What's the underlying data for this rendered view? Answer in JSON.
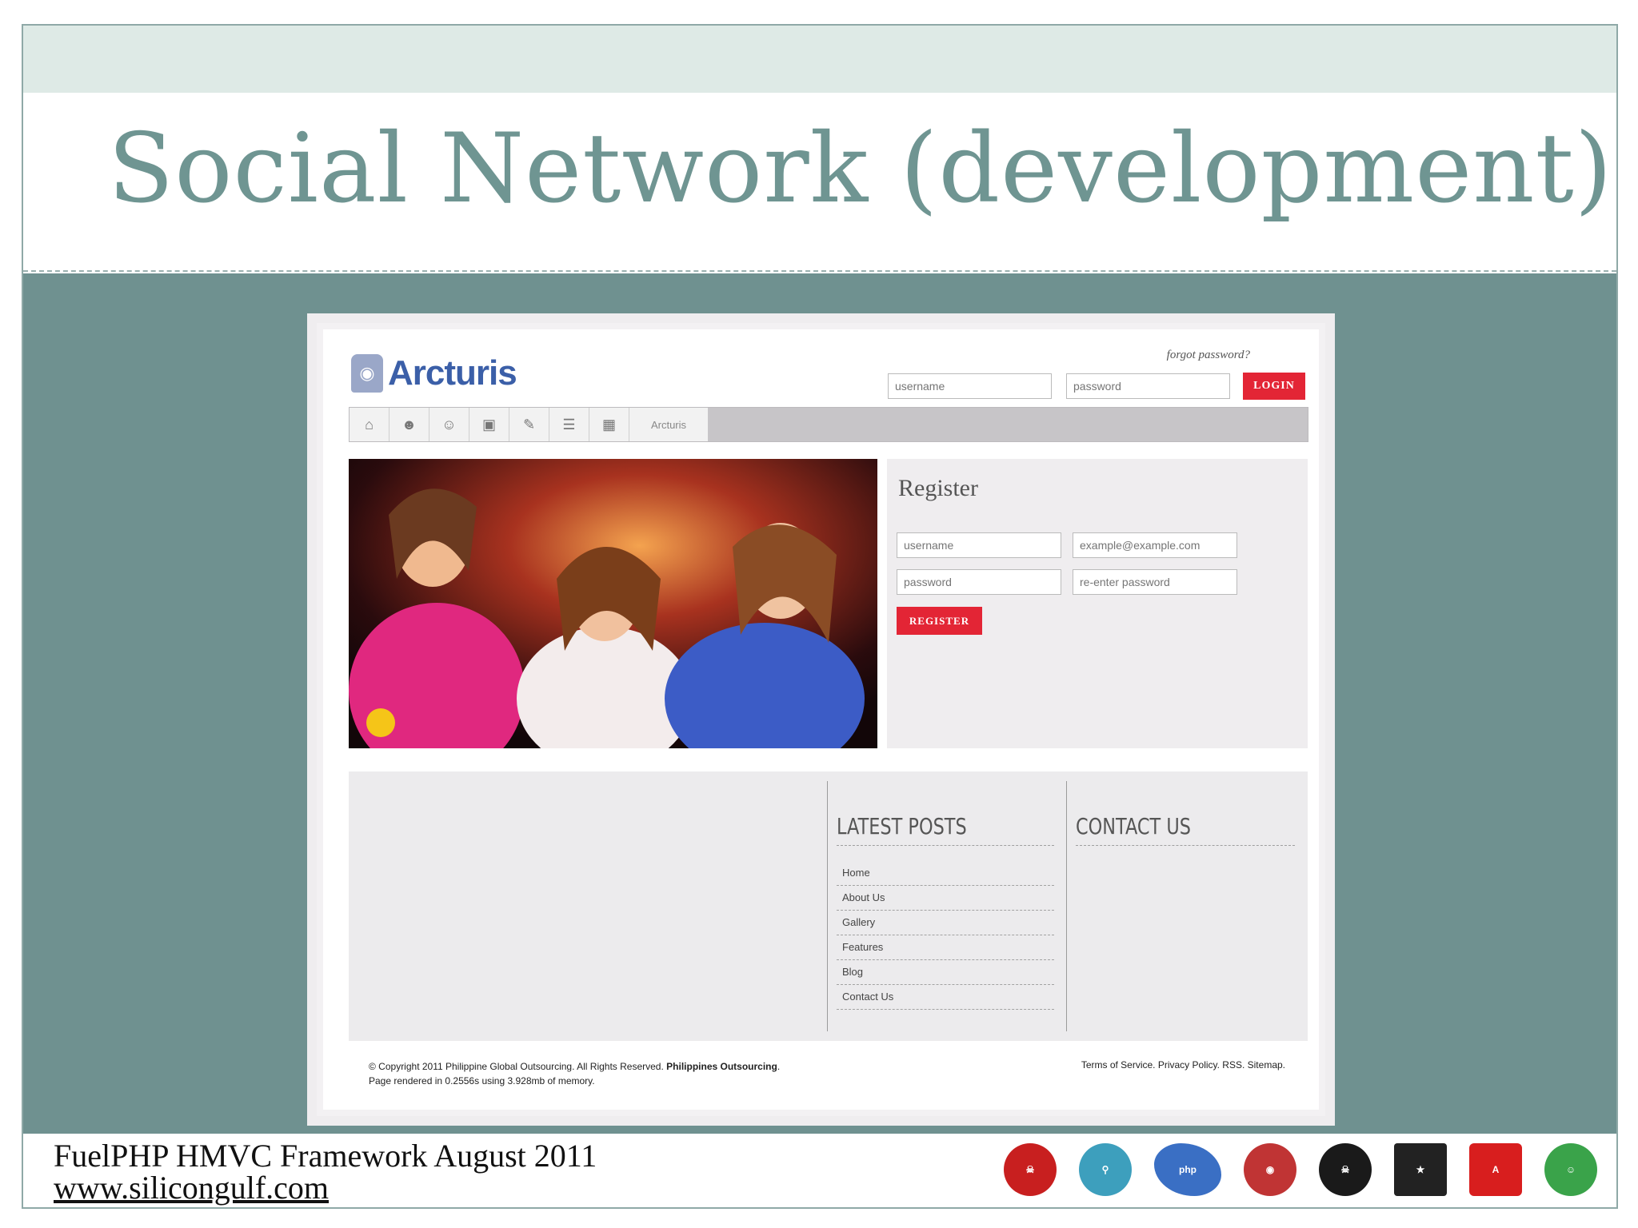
{
  "slide": {
    "title": "Social Network (development)",
    "footer_line1": "FuelPHP HMVC Framework August 2011",
    "footer_line2": "www.silicongulf.com"
  },
  "logos": [
    "sniper-thermos-logo",
    "silicongulf-logo",
    "php-logo",
    "red-shield-logo",
    "skull-logo",
    "kickstart-logo",
    "adobe-user-group-logo",
    "green-face-logo"
  ],
  "site": {
    "brand": "Arcturis",
    "forgot_password": "forgot password?",
    "login": {
      "username_placeholder": "username",
      "password_placeholder": "password",
      "button": "LOGIN"
    },
    "nav": {
      "icons": [
        "home-icon",
        "user-icon",
        "users-icon",
        "image-icon",
        "edit-icon",
        "list-icon",
        "book-icon"
      ],
      "text_item": "Arcturis"
    },
    "register": {
      "title": "Register",
      "username_placeholder": "username",
      "email_placeholder": "example@example.com",
      "password_placeholder": "password",
      "reenter_placeholder": "re-enter password",
      "button": "REGISTER"
    },
    "latest_posts": {
      "heading": "LATEST POSTS",
      "items": [
        "Home",
        "About Us",
        "Gallery",
        "Features",
        "Blog",
        "Contact Us"
      ]
    },
    "contact": {
      "heading": "CONTACT US"
    },
    "footer": {
      "copyright_prefix": "© Copyright 2011 Philippine Global Outsourcing. All Rights Reserved.",
      "copyright_bold": "Philippines Outsourcing",
      "copyright_suffix": ".",
      "rendered": "Page rendered in 0.2556s using 3.928mb of memory.",
      "links": "Terms of Service. Privacy Policy. RSS. Sitemap."
    }
  },
  "colors": {
    "teal": "#6f9190",
    "title": "#6f9592",
    "accent_red": "#e32535",
    "brand_blue": "#3b5fa8"
  }
}
